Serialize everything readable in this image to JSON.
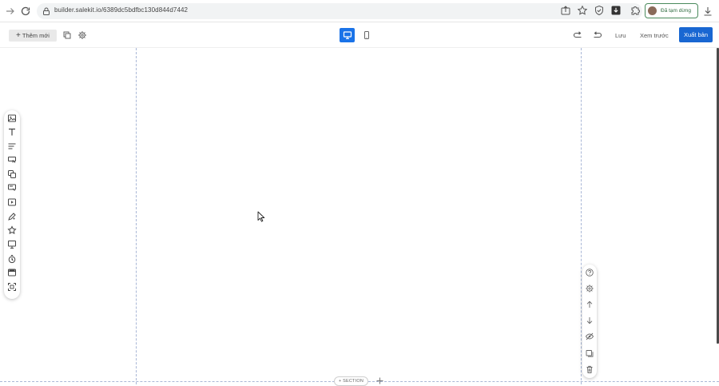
{
  "browser": {
    "url": "builder.salekit.io/6389dc5bdfbc130d844d7442",
    "paused_label": "Đã tạm dừng",
    "icons": [
      "arrow-forward-icon",
      "reload-icon",
      "lock-icon",
      "share-icon",
      "star-icon",
      "shield-icon",
      "extension-download-icon",
      "puzzle-icon",
      "download-icon"
    ]
  },
  "toolbar": {
    "add_new_label": "Thêm mới",
    "save_label": "Lưu",
    "preview_label": "Xem trước",
    "publish_label": "Xuất bản",
    "active_device": "desktop",
    "accent_color": "#1a73e8"
  },
  "left_palette": {
    "items": [
      "image-icon",
      "text-icon",
      "paragraph-icon",
      "button-icon",
      "group-icon",
      "form-icon",
      "video-icon",
      "rating-icon",
      "star-icon",
      "slide-icon",
      "countdown-icon",
      "popup-icon",
      "frame-icon"
    ]
  },
  "right_toolbar": {
    "items": [
      "help-icon",
      "settings-icon",
      "move-up-icon",
      "move-down-icon",
      "hide-icon",
      "duplicate-icon",
      "delete-icon"
    ]
  },
  "section": {
    "add_label": "+ SECTION"
  }
}
